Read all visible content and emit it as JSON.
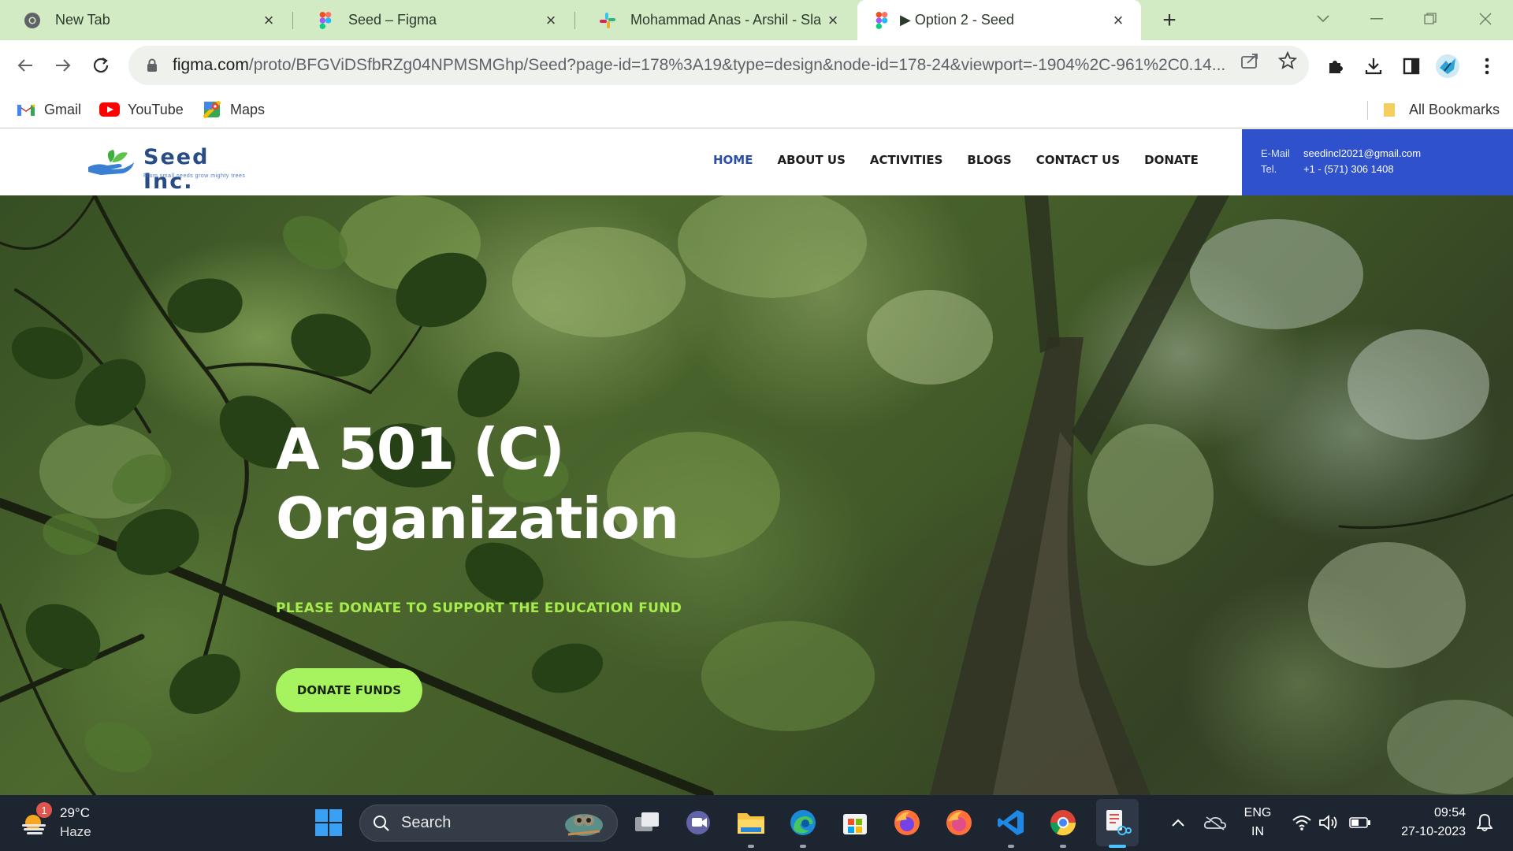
{
  "browser": {
    "tabs": [
      {
        "title": "New Tab",
        "active": false
      },
      {
        "title": "Seed – Figma",
        "active": false
      },
      {
        "title": "Mohammad Anas - Arshil - Slack",
        "active": false
      },
      {
        "title": "▶ Option 2 - Seed",
        "active": true
      }
    ],
    "url_host": "figma.com",
    "url_path": "/proto/BFGViDSfbRZg04NPMSMGhp/Seed?page-id=178%3A19&type=design&node-id=178-24&viewport=-1904%2C-961%2C0.14...",
    "bookmarks": [
      {
        "label": "Gmail",
        "icon": "gmail-icon"
      },
      {
        "label": "YouTube",
        "icon": "youtube-icon"
      },
      {
        "label": "Maps",
        "icon": "maps-icon"
      }
    ],
    "all_bookmarks": "All Bookmarks"
  },
  "site": {
    "brand": "Seed Inc.",
    "tagline": "From small seeds grow mighty trees",
    "nav": [
      {
        "label": "HOME",
        "active": true
      },
      {
        "label": "ABOUT US",
        "active": false
      },
      {
        "label": "ACTIVITIES",
        "active": false
      },
      {
        "label": "BLOGS",
        "active": false
      },
      {
        "label": "CONTACT US",
        "active": false
      },
      {
        "label": "DONATE",
        "active": false
      }
    ],
    "contact": {
      "email_label": "E-Mail",
      "email": "seedincl2021@gmail.com",
      "tel_label": "Tel.",
      "tel": "+1 - (571) 306 1408"
    },
    "hero": {
      "headline_line1": "A 501 (C)",
      "headline_line2": "Organization",
      "subheading": "PLEASE DONATE TO SUPPORT THE EDUCATION FUND",
      "cta": "DONATE FUNDS"
    },
    "colors": {
      "nav_active": "#2b4ea7",
      "contact_bg": "#2f52cc",
      "accent_green": "#a6ec4c",
      "cta_bg": "#a7f35f"
    }
  },
  "taskbar": {
    "weather_temp": "29°C",
    "weather_cond": "Haze",
    "weather_badge": "1",
    "search_label": "Search",
    "lang_line1": "ENG",
    "lang_line2": "IN",
    "time": "09:54",
    "date": "27-10-2023"
  }
}
